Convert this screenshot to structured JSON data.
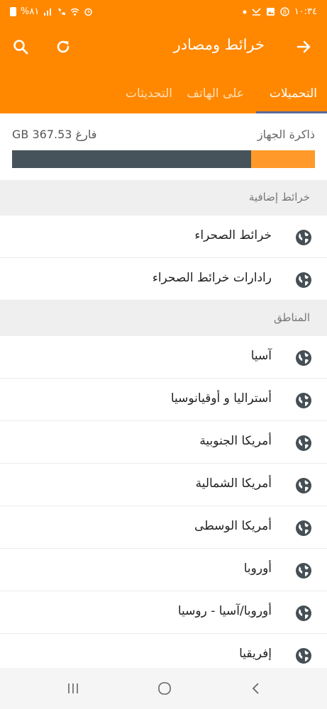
{
  "status_bar": {
    "time": "١٠:٣٤",
    "battery": "%٨١"
  },
  "app_bar": {
    "title": "خرائط ومصادر",
    "icons": [
      "back-arrow-icon",
      "search-icon",
      "refresh-icon"
    ]
  },
  "tabs": [
    {
      "label": "التحميلات",
      "active": true
    },
    {
      "label": "على الهاتف",
      "active": false
    },
    {
      "label": "التحديثات",
      "active": false
    }
  ],
  "memory": {
    "label": "ذاكرة الجهاز",
    "free_text": "فارغ GB 367.53",
    "used_fraction": 0.79,
    "colors": {
      "used": "#47535a",
      "free": "#ff9a2a"
    }
  },
  "sections": {
    "extra_maps": {
      "header": "خرائط إضافية",
      "items": [
        "خرائط الصحراء",
        "رادارات خرائط الصحراء"
      ]
    },
    "regions": {
      "header": "المناطق",
      "items": [
        "آسيا",
        "أستراليا و أوقيانوسيا",
        "أمريكا الجنوبية",
        "أمريكا الشمالية",
        "أمريكا الوسطى",
        "أوروبا",
        "أوروبا/آسيا - روسيا",
        "إفريقيا"
      ]
    }
  },
  "accent_color": "#ff8800"
}
